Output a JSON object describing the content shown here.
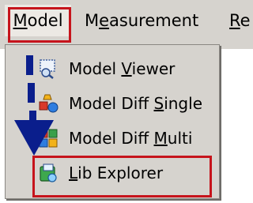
{
  "menubar": {
    "items": [
      {
        "label": "Model",
        "mnemonic": "M"
      },
      {
        "label": "Measurement",
        "mnemonic": "e"
      },
      {
        "label": "Re",
        "mnemonic": "R"
      }
    ]
  },
  "dropdown": {
    "items": [
      {
        "label": "Model Viewer",
        "pre": "Model ",
        "mn": "V",
        "post": "iewer",
        "icon": "model-viewer-icon"
      },
      {
        "label": "Model Diff Single",
        "pre": "Model Diff ",
        "mn": "S",
        "post": "ingle",
        "icon": "model-diff-single-icon"
      },
      {
        "label": "Model Diff Multi",
        "pre": "Model Diff ",
        "mn": "M",
        "post": "ulti",
        "icon": "model-diff-multi-icon"
      },
      {
        "label": "Lib Explorer",
        "pre": "",
        "mn": "L",
        "post": "ib Explorer",
        "icon": "lib-explorer-icon"
      }
    ]
  },
  "annotation": {
    "highlight_color": "#c6141c",
    "arrow_color": "#0a1e8c"
  }
}
